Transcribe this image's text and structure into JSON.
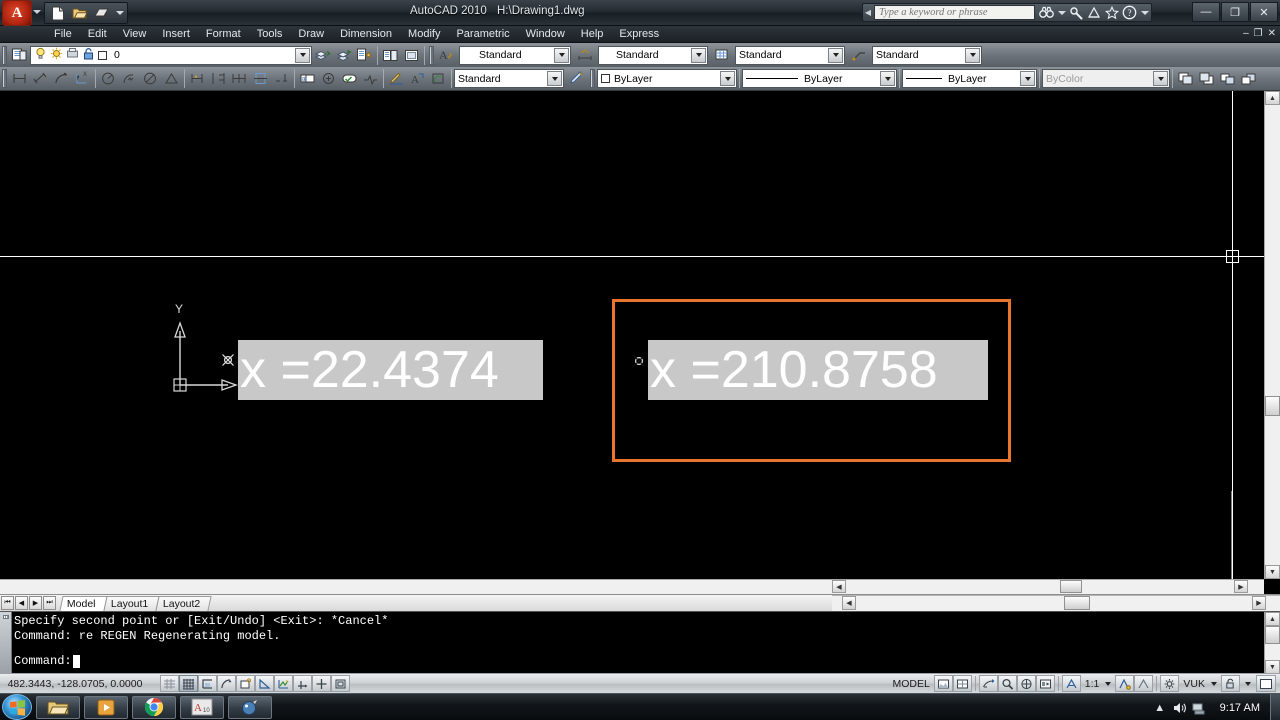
{
  "titlebar": {
    "app_menu_label": "A",
    "product": "AutoCAD 2010",
    "filename": "H:\\Drawing1.dwg",
    "qat": [
      {
        "name": "new-file-icon",
        "label": "New"
      },
      {
        "name": "open-file-icon",
        "label": "Open"
      },
      {
        "name": "save-file-icon",
        "label": "Save"
      }
    ],
    "search_placeholder": "Type a keyword or phrase",
    "search_value": "",
    "search_icons": [
      "search-binoculars-icon",
      "communication-center-icon",
      "sign-in-icon",
      "favorites-star-icon",
      "help-question-icon"
    ],
    "window_controls": {
      "minimize": "—",
      "restore": "❐",
      "close": "✕"
    },
    "doc_controls": {
      "minimize": "–",
      "restore": "❐",
      "close": "✕"
    }
  },
  "menubar": {
    "items": [
      "File",
      "Edit",
      "View",
      "Insert",
      "Format",
      "Tools",
      "Draw",
      "Dimension",
      "Modify",
      "Parametric",
      "Window",
      "Help",
      "Express"
    ]
  },
  "toolbars": {
    "layer": {
      "layer_name": "0",
      "states": [
        "layer-on-bulb-icon",
        "layer-freeze-sun-icon",
        "layer-plot-icon",
        "layer-lock-icon",
        "layer-color-swatch"
      ]
    },
    "text_style": "Standard",
    "dim_style": "Standard",
    "table_style": "Standard",
    "mleader_style": "Standard",
    "multileader_style": "Standard",
    "properties": {
      "color": "ByLayer",
      "linetype": "ByLayer",
      "lineweight": "ByLayer",
      "plot_style": "ByColor"
    }
  },
  "canvas": {
    "background": "#000000",
    "ucs": {
      "x_label": "",
      "y_label": "Y"
    },
    "entities": [
      {
        "name": "text-entity-1",
        "text": "x =22.4374",
        "selected": false
      },
      {
        "name": "text-entity-2",
        "text": "x =210.8758",
        "selected": true
      }
    ],
    "editor_border_color": "#e8762c",
    "text_highlight_color": "#c8c8c8"
  },
  "tabs": {
    "nav": [
      "⏮",
      "◀",
      "▶",
      "⏭"
    ],
    "items": [
      {
        "label": "Model",
        "active": true
      },
      {
        "label": "Layout1",
        "active": false
      },
      {
        "label": "Layout2",
        "active": false
      }
    ]
  },
  "command_window": {
    "history": [
      "Specify second point or [Exit/Undo] <Exit>: *Cancel*",
      "Command: re REGEN Regenerating model."
    ],
    "prompt": "Command:",
    "input_value": ""
  },
  "statusbar": {
    "coordinates": "482.3443, -128.0705, 0.0000",
    "toggles": [
      {
        "name": "infer-constraints-toggle",
        "label": "⌗",
        "on": false
      },
      {
        "name": "snap-grid-toggle",
        "label": "▦",
        "on": true
      },
      {
        "name": "grid-display-toggle",
        "label": "⊞",
        "on": false
      },
      {
        "name": "ortho-mode-toggle",
        "label": "⌐",
        "on": false
      },
      {
        "name": "polar-tracking-toggle",
        "label": "∠",
        "on": false
      },
      {
        "name": "object-snap-toggle",
        "label": "⊿",
        "on": false
      },
      {
        "name": "osnap-tracking-toggle",
        "label": "⌁",
        "on": false
      },
      {
        "name": "dynamic-ucs-toggle",
        "label": "⊥",
        "on": false
      },
      {
        "name": "dynamic-input-toggle",
        "label": "+",
        "on": false
      },
      {
        "name": "lineweight-toggle",
        "label": "▤",
        "on": false
      }
    ],
    "space_label": "MODEL",
    "layout_icons": [
      "model-space-icon",
      "paper-space-icon"
    ],
    "view_icons": [
      "quick-view-layouts-icon",
      "pan-icon",
      "zoom-icon",
      "steering-wheel-icon",
      "showmotion-icon"
    ],
    "annotation_scale": "1:1",
    "annotation_icons": [
      "annotation-visibility-icon",
      "auto-scale-icon"
    ],
    "workspace_label": "VUK",
    "workspace_icon": "gear-icon",
    "lock_icon": "toolbar-lock-icon",
    "clean_screen_icon": "clean-screen-icon"
  },
  "taskbar": {
    "start_label": "",
    "apps": [
      {
        "name": "taskbar-explorer",
        "label": "📁"
      },
      {
        "name": "taskbar-media-player",
        "label": "▶"
      },
      {
        "name": "taskbar-chrome",
        "label": "◉"
      },
      {
        "name": "taskbar-autocad",
        "label": "A"
      },
      {
        "name": "taskbar-game",
        "label": "✦"
      }
    ],
    "tray": {
      "show_hidden": "▲",
      "volume_icon": "speaker-icon",
      "network_icon": "network-icon",
      "clock": "9:17 AM"
    }
  }
}
